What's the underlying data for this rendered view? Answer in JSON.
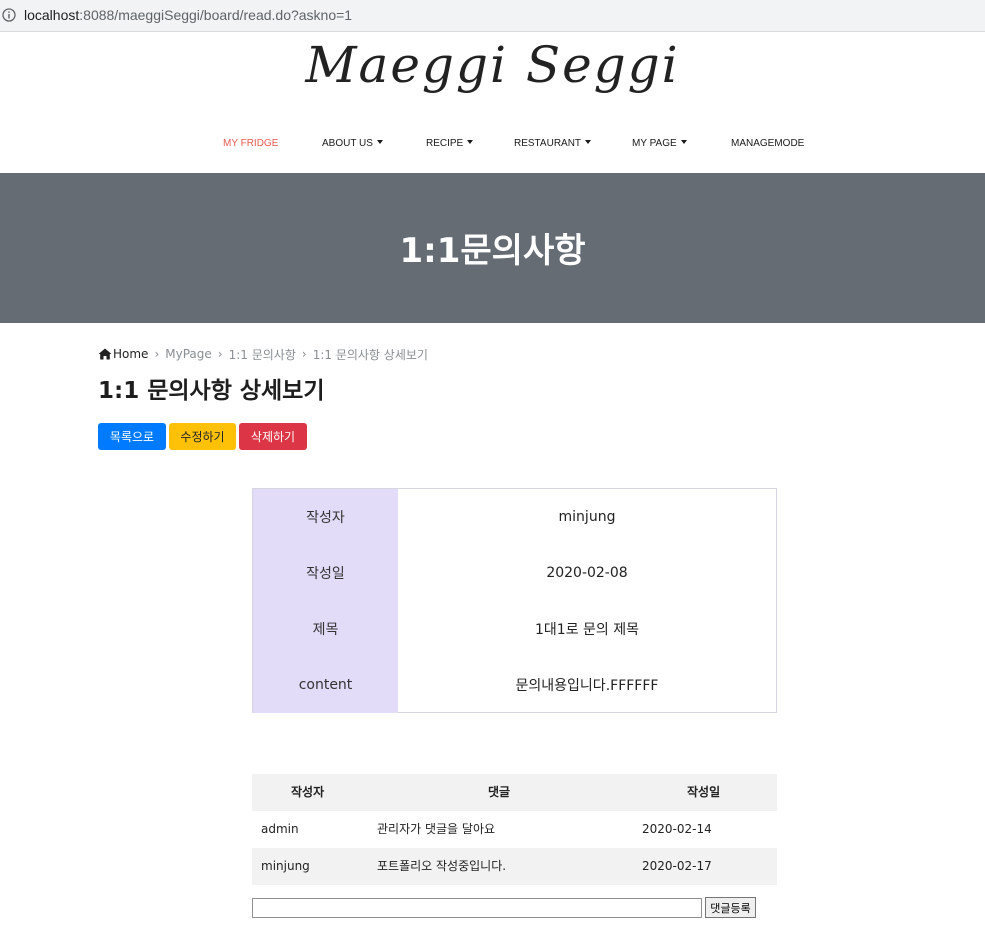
{
  "browser": {
    "url_host": "localhost",
    "url_rest": ":8088/maeggiSeggi/board/read.do?askno=1"
  },
  "site": {
    "logo": "Maeggi Seggi"
  },
  "nav": {
    "items": [
      {
        "label": "MY FRIDGE",
        "dropdown": false,
        "active": true
      },
      {
        "label": "ABOUT US",
        "dropdown": true,
        "active": false
      },
      {
        "label": "RECIPE",
        "dropdown": true,
        "active": false
      },
      {
        "label": "RESTAURANT",
        "dropdown": true,
        "active": false
      },
      {
        "label": "MY PAGE",
        "dropdown": true,
        "active": false
      },
      {
        "label": "MANAGEMODE",
        "dropdown": false,
        "active": false
      }
    ]
  },
  "banner": {
    "title": "1:1문의사항"
  },
  "breadcrumb": {
    "home": "Home",
    "items": [
      "MyPage",
      "1:1 문의사항",
      "1:1 문의사항 상세보기"
    ]
  },
  "page": {
    "title": "1:1 문의사항 상세보기"
  },
  "actions": {
    "list_label": "목록으로",
    "edit_label": "수정하기",
    "delete_label": "삭제하기"
  },
  "detail": {
    "rows": [
      {
        "label": "작성자",
        "value": "minjung"
      },
      {
        "label": "작성일",
        "value": "2020-02-08"
      },
      {
        "label": "제목",
        "value": "1대1로 문의 제목"
      },
      {
        "label": "content",
        "value": "문의내용입니다.FFFFFF"
      }
    ]
  },
  "comments": {
    "headers": [
      "작성자",
      "댓글",
      "작성일"
    ],
    "rows": [
      {
        "author": "admin",
        "text": "관리자가 댓글을 달아요",
        "date": "2020-02-14"
      },
      {
        "author": "minjung",
        "text": "포트폴리오 작성중입니다.",
        "date": "2020-02-17"
      }
    ]
  },
  "reply": {
    "input_value": "",
    "submit_label": "댓글등록"
  },
  "colors": {
    "accent_nav": "#e85a4f",
    "banner_bg": "#656c73",
    "label_bg": "#e2dcf8",
    "btn_primary": "#007bff",
    "btn_warning": "#ffc107",
    "btn_danger": "#dc3545"
  },
  "icons": {
    "info": "info-icon",
    "home": "home-icon"
  }
}
